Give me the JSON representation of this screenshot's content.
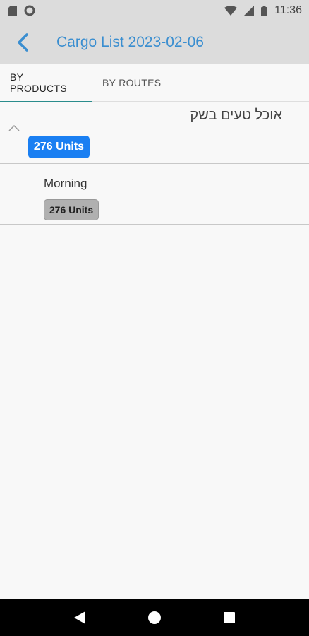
{
  "status_bar": {
    "time": "11:36",
    "icons_left": [
      "sim-card-icon",
      "circle-notification-icon"
    ],
    "icons_right": [
      "wifi-icon",
      "signal-icon",
      "battery-icon"
    ]
  },
  "app_bar": {
    "back_icon": "back-arrow-icon",
    "title": "Cargo List 2023-02-06",
    "accent_color": "#3a8ed0"
  },
  "tabs": [
    {
      "label": "BY PRODUCTS",
      "active": true
    },
    {
      "label": "BY ROUTES",
      "active": false
    }
  ],
  "group": {
    "title": "אוכל טעים בשק",
    "expanded": true,
    "units_badge": "276 Units",
    "badge_color": "#1a7ff2"
  },
  "sub_items": [
    {
      "label": "Morning",
      "units_badge": "276 Units",
      "badge_color": "#b0b0b0"
    }
  ],
  "nav_bar": {
    "buttons": [
      "back-triangle-icon",
      "home-circle-icon",
      "recents-square-icon"
    ]
  }
}
